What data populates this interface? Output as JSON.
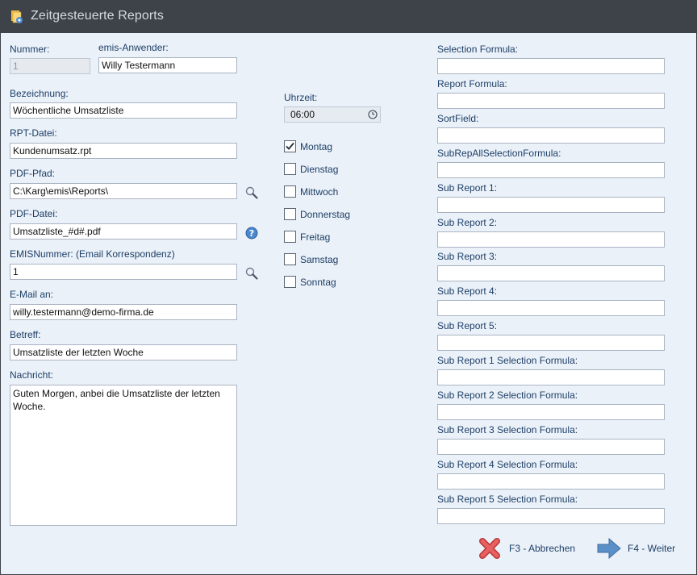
{
  "window": {
    "title": "Zeitgesteuerte Reports",
    "icon": "reports-app-icon"
  },
  "form": {
    "nummer": {
      "label": "Nummer:",
      "value": "1"
    },
    "anwender": {
      "label": "emis-Anwender:",
      "value": "Willy Testermann"
    },
    "bezeichnung": {
      "label": "Bezeichnung:",
      "value": "Wöchentliche Umsatzliste"
    },
    "rpt": {
      "label": "RPT-Datei:",
      "value": "Kundenumsatz.rpt"
    },
    "pdf_pfad": {
      "label": "PDF-Pfad:",
      "value": "C:\\Karg\\emis\\Reports\\"
    },
    "pdf_datei": {
      "label": "PDF-Datei:",
      "value": "Umsatzliste_#d#.pdf"
    },
    "emis_nummer": {
      "label": "EMISNummer: (Email Korrespondenz)",
      "value": "1"
    },
    "email": {
      "label": "E-Mail an:",
      "value": "willy.testermann@demo-firma.de"
    },
    "betreff": {
      "label": "Betreff:",
      "value": "Umsatzliste der letzten Woche"
    },
    "nachricht": {
      "label": "Nachricht:",
      "value": "Guten Morgen, anbei die Umsatzliste der letzten Woche."
    }
  },
  "schedule": {
    "time_label": "Uhrzeit:",
    "time_value": "06:00",
    "days": [
      {
        "label": "Montag",
        "checked": true
      },
      {
        "label": "Dienstag",
        "checked": false
      },
      {
        "label": "Mittwoch",
        "checked": false
      },
      {
        "label": "Donnerstag",
        "checked": false
      },
      {
        "label": "Freitag",
        "checked": false
      },
      {
        "label": "Samstag",
        "checked": false
      },
      {
        "label": "Sonntag",
        "checked": false
      }
    ]
  },
  "formulas": [
    {
      "label": "Selection Formula:",
      "value": ""
    },
    {
      "label": "Report Formula:",
      "value": ""
    },
    {
      "label": "SortField:",
      "value": ""
    },
    {
      "label": "SubRepAllSelectionFormula:",
      "value": ""
    },
    {
      "label": "Sub Report 1:",
      "value": ""
    },
    {
      "label": "Sub Report 2:",
      "value": ""
    },
    {
      "label": "Sub Report 3:",
      "value": ""
    },
    {
      "label": "Sub Report 4:",
      "value": ""
    },
    {
      "label": "Sub Report 5:",
      "value": ""
    },
    {
      "label": "Sub Report 1 Selection Formula:",
      "value": ""
    },
    {
      "label": "Sub Report 2 Selection Formula:",
      "value": ""
    },
    {
      "label": "Sub Report 3 Selection Formula:",
      "value": ""
    },
    {
      "label": "Sub Report 4 Selection Formula:",
      "value": ""
    },
    {
      "label": "Sub Report 5 Selection Formula:",
      "value": ""
    }
  ],
  "footer": {
    "cancel_label": "F3 - Abbrechen",
    "next_label": "F4 - Weiter"
  },
  "colors": {
    "titlebar": "#3d4349",
    "background": "#ebf1f9",
    "label": "#1d3f66",
    "cancel_icon": "#e25b5b",
    "next_icon": "#5b8fc7"
  }
}
